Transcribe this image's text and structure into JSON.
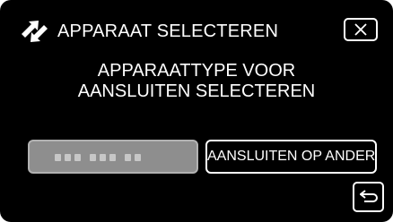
{
  "header": {
    "title": "APPARAAT SELECTEREN",
    "icon": "connection-arrows-icon",
    "close_icon": "close-icon"
  },
  "message": {
    "line1": "APPARAATTYPE VOOR",
    "line2": "AANSLUITEN SELECTEREN"
  },
  "buttons": {
    "connect_other_label": "AANSLUITEN OP ANDER",
    "disabled_option_icon": "dotted-placeholder-icon",
    "back_icon": "return-arrow-icon"
  },
  "colors": {
    "background": "#000000",
    "text": "#ffffff",
    "disabled_button": "#8e8e8e"
  }
}
